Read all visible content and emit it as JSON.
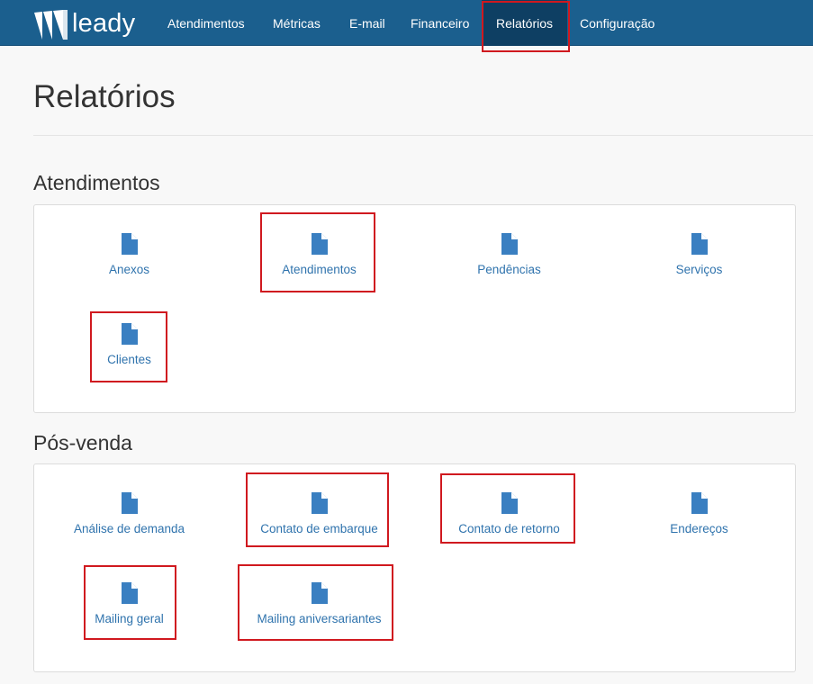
{
  "brand": {
    "name": "leady"
  },
  "nav": [
    {
      "label": "Atendimentos"
    },
    {
      "label": "Métricas"
    },
    {
      "label": "E-mail"
    },
    {
      "label": "Financeiro"
    },
    {
      "label": "Relatórios",
      "active": true
    },
    {
      "label": "Configuração"
    }
  ],
  "page": {
    "title": "Relatórios"
  },
  "sections": [
    {
      "title": "Atendimentos",
      "reports": [
        {
          "label": "Anexos",
          "icon": "file-icon"
        },
        {
          "label": "Atendimentos",
          "icon": "file-icon"
        },
        {
          "label": "Pendências",
          "icon": "file-icon"
        },
        {
          "label": "Serviços",
          "icon": "file-icon"
        },
        {
          "label": "Clientes",
          "icon": "file-icon"
        }
      ]
    },
    {
      "title": "Pós-venda",
      "reports": [
        {
          "label": "Análise de demanda",
          "icon": "file-icon"
        },
        {
          "label": "Contato de embarque",
          "icon": "file-icon"
        },
        {
          "label": "Contato de retorno",
          "icon": "file-icon"
        },
        {
          "label": "Endereços",
          "icon": "file-icon"
        },
        {
          "label": "Mailing geral",
          "icon": "file-icon"
        },
        {
          "label": "Mailing aniversariantes",
          "icon": "file-icon"
        }
      ]
    }
  ],
  "colors": {
    "navbar": "#1b5f8e",
    "nav_active": "#0e3f63",
    "link": "#2f73ad",
    "highlight": "#d0191f"
  }
}
